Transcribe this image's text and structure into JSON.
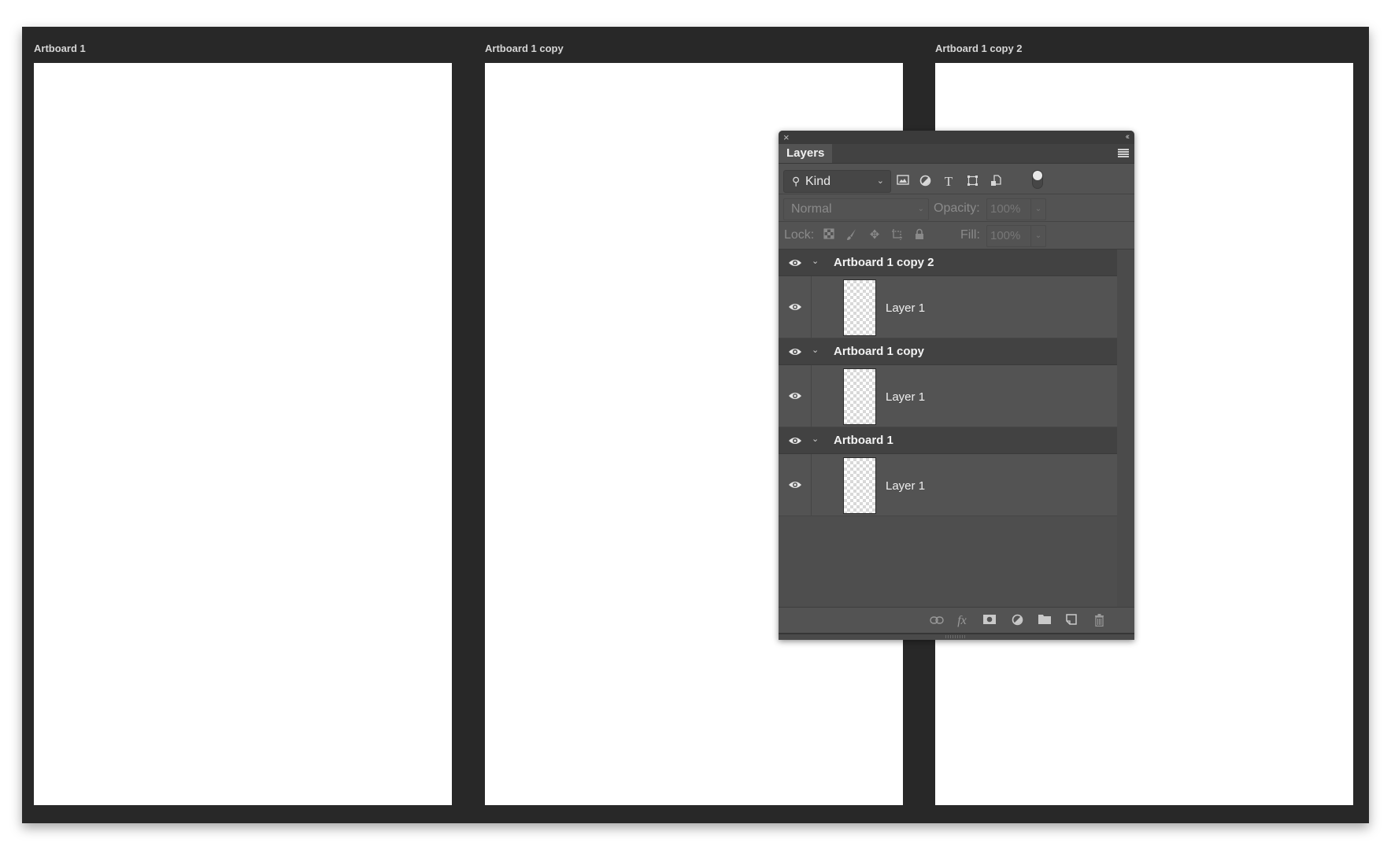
{
  "artboards": [
    {
      "label": "Artboard 1"
    },
    {
      "label": "Artboard 1 copy"
    },
    {
      "label": "Artboard 1 copy 2"
    }
  ],
  "layers_panel": {
    "close_icon": "×",
    "collapse_icon": "‹‹",
    "tab_label": "Layers",
    "filter": {
      "kind_label": "Kind",
      "icons": [
        "pixel-layer-filter-icon",
        "adjustment-layer-filter-icon",
        "type-layer-filter-icon",
        "shape-layer-filter-icon",
        "smart-object-filter-icon"
      ],
      "filter_toggle_on": true
    },
    "blend_mode": "Normal",
    "opacity_label": "Opacity:",
    "opacity_value": "100%",
    "lock_label": "Lock:",
    "fill_label": "Fill:",
    "fill_value": "100%",
    "groups": [
      {
        "name": "Artboard 1 copy 2",
        "visible": true,
        "expanded": true,
        "layers": [
          {
            "name": "Layer 1",
            "visible": true
          }
        ]
      },
      {
        "name": "Artboard 1 copy",
        "visible": true,
        "expanded": true,
        "layers": [
          {
            "name": "Layer 1",
            "visible": true
          }
        ]
      },
      {
        "name": "Artboard 1",
        "visible": true,
        "expanded": true,
        "layers": [
          {
            "name": "Layer 1",
            "visible": true
          }
        ]
      }
    ],
    "footer_icons": [
      "link-layers-icon",
      "fx-icon",
      "add-mask-icon",
      "new-adjustment-icon",
      "new-group-icon",
      "new-layer-icon",
      "delete-layer-icon"
    ],
    "fx_label": "fx"
  }
}
